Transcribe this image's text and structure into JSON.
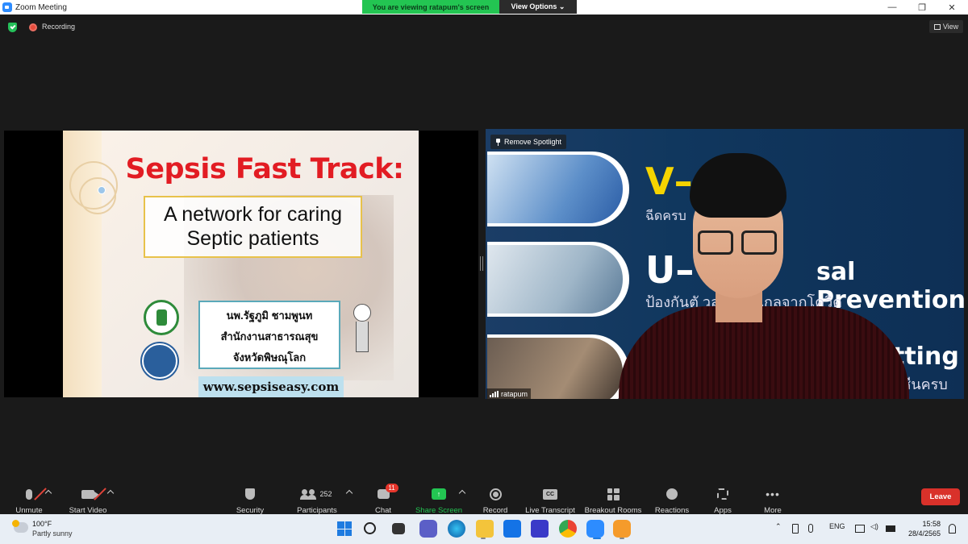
{
  "window": {
    "title": "Zoom Meeting",
    "minimize": "—",
    "maximize": "❐",
    "close": "✕"
  },
  "banner": {
    "viewing_text": "You are viewing ratapum's screen",
    "options_label": "View Options ⌄"
  },
  "status": {
    "recording_label": "Recording",
    "view_label": "View"
  },
  "slide": {
    "title": "Sepsis Fast Track:",
    "subtitle_line1": "A network for caring",
    "subtitle_line2": "Septic patients",
    "presenter_line1": "นพ.รัฐภูมิ ชามพูนท",
    "presenter_line2": "สำนักงานสาธารณสุข",
    "presenter_line3": "จังหวัดพิษณุโลก",
    "website": "www.sepsiseasy.com"
  },
  "video": {
    "letter_v": "V–",
    "letter_u": "U–",
    "thai_1": "ฉีดครบ",
    "text_2": "sal Prevention",
    "thai_2": "ป้องกันตั      วลา ห่างไกลจากโควิด",
    "text_3": "tting",
    "thai_3": "าซีนครบ",
    "remove_spotlight": "Remove Spotlight",
    "participant_name": "ratapum"
  },
  "toolbar": {
    "unmute": "Unmute",
    "start_video": "Start Video",
    "security": "Security",
    "participants": "Participants",
    "participants_count": "252",
    "chat": "Chat",
    "chat_badge": "11",
    "share_screen": "Share Screen",
    "record": "Record",
    "live_transcript": "Live Transcript",
    "cc": "CC",
    "breakout_rooms": "Breakout Rooms",
    "reactions": "Reactions",
    "apps": "Apps",
    "more": "More",
    "more_glyph": "•••",
    "leave": "Leave"
  },
  "taskbar": {
    "temperature": "100°F",
    "condition": "Partly sunny",
    "language": "ENG",
    "time": "15:58",
    "date": "28/4/2565"
  },
  "colors": {
    "accent_green": "#23c552",
    "leave_red": "#d9312a",
    "slide_title_red": "#e21c23",
    "badge_red": "#e5352b"
  },
  "icons": [
    "zoom-app-icon",
    "shield-icon",
    "record-dot-icon",
    "grid-view-icon",
    "pin-icon",
    "signal-icon",
    "microphone-muted-icon",
    "camera-off-icon",
    "security-icon",
    "participants-icon",
    "chat-icon",
    "share-screen-icon",
    "record-icon",
    "cc-icon",
    "breakout-rooms-icon",
    "reactions-icon",
    "apps-icon",
    "more-icon",
    "weather-icon",
    "windows-start-icon",
    "search-icon",
    "file-explorer-icon",
    "edge-icon",
    "chrome-icon",
    "zoom-taskbar-icon"
  ]
}
